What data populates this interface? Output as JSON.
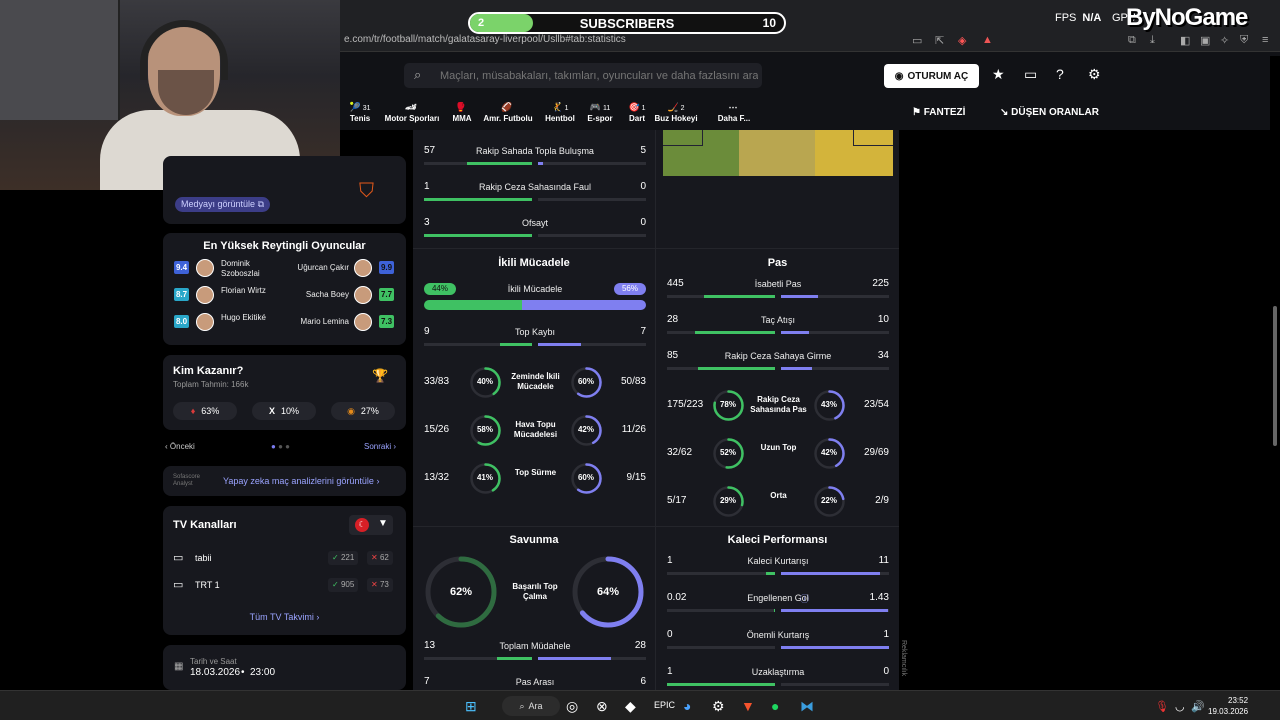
{
  "overlay": {
    "subscribers": {
      "label": "SUBSCRIBERS",
      "min": "2",
      "max": "10",
      "progress": 0.2
    },
    "fps_label": "FPS",
    "fps_value": "N/A",
    "gpu_label": "GPU",
    "logo": "ByNoGame"
  },
  "browser": {
    "url": "e.com/tr/football/match/galatasaray-liverpool/Usllb#tab:statistics"
  },
  "header": {
    "search_placeholder": "Maçları, müsabakaları, takımları, oyuncuları ve daha fazlasını ara",
    "login": "OTURUM AÇ",
    "sports": [
      {
        "label": "Tenis",
        "count": "31",
        "icon": "🎾"
      },
      {
        "label": "Motor Sporları",
        "count": "",
        "icon": "🏎"
      },
      {
        "label": "MMA",
        "count": "",
        "icon": "🥊"
      },
      {
        "label": "Amr. Futbolu",
        "count": "",
        "icon": "🏈"
      },
      {
        "label": "Hentbol",
        "count": "1",
        "icon": "🤾"
      },
      {
        "label": "E-spor",
        "count": "11",
        "icon": "🎮"
      },
      {
        "label": "Dart",
        "count": "1",
        "icon": "🎯"
      },
      {
        "label": "Buz Hokeyi",
        "count": "2",
        "icon": "🏒"
      },
      {
        "label": "Daha F...",
        "count": "",
        "icon": "⋯"
      }
    ],
    "fantezi": "FANTEZİ",
    "dusen": "DÜŞEN ORANLAR"
  },
  "media": {
    "label": "Medyayı görüntüle"
  },
  "top_players": {
    "title": "En Yüksek Reytingli Oyuncular",
    "rows": [
      {
        "l_rating": "9.4",
        "l_name": "Dominik Szoboszlai",
        "r_name": "Uğurcan Çakır",
        "r_rating": "9.9",
        "l_color": "#3e62d8",
        "r_color": "#3e62d8"
      },
      {
        "l_rating": "8.7",
        "l_name": "Florian Wirtz",
        "r_name": "Sacha Boey",
        "r_rating": "7.7",
        "l_color": "#2aa7c9",
        "r_color": "#3fc163"
      },
      {
        "l_rating": "8.0",
        "l_name": "Hugo Ekitiké",
        "r_name": "Mario Lemina",
        "r_rating": "7.3",
        "l_color": "#2aa7c9",
        "r_color": "#3fc163"
      }
    ]
  },
  "who_wins": {
    "title": "Kim Kazanır?",
    "subtitle": "Toplam Tahmin: 166k",
    "home": "63%",
    "draw_label": "X",
    "draw": "10%",
    "away": "27%"
  },
  "pager": {
    "prev": "Önceki",
    "next": "Sonraki"
  },
  "ai": {
    "logo_line1": "Sofascore",
    "logo_line2": "Analyst",
    "text": "Yapay zeka maç analizlerini görüntüle"
  },
  "tv": {
    "title": "TV Kanalları",
    "channels": [
      {
        "name": "tabii",
        "up": "221",
        "down": "62"
      },
      {
        "name": "TRT 1",
        "up": "905",
        "down": "73"
      }
    ],
    "all": "Tüm TV Takvimi"
  },
  "date": {
    "label": "Tarih ve Saat",
    "date": "18.03.2026",
    "time": "23:00"
  },
  "stats": {
    "top_rows": [
      {
        "label": "Rakip Sahada Topla Buluşma",
        "l": "57",
        "r": "5",
        "lf": 0.6,
        "rf": 0.05
      },
      {
        "label": "Rakip Ceza Sahasında Faul",
        "l": "1",
        "r": "0",
        "lf": 1.0,
        "rf": 0
      },
      {
        "label": "Ofsayt",
        "l": "3",
        "r": "0",
        "lf": 1.0,
        "rf": 0
      }
    ],
    "duels": {
      "title": "İkili Mücadele",
      "main_label": "İkili Mücadele",
      "l_pct": "44%",
      "r_pct": "56%",
      "l_frac": 0.44,
      "row": {
        "label": "Top Kaybı",
        "l": "9",
        "r": "7",
        "lf": 0.3,
        "rf": 0.4
      },
      "rings": [
        {
          "label": "Zeminde İkili Mücadele",
          "l": "33/83",
          "lp": "40%",
          "lv": 0.4,
          "rp": "60%",
          "rv": 0.6,
          "r": "50/83"
        },
        {
          "label": "Hava Topu Mücadelesi",
          "l": "15/26",
          "lp": "58%",
          "lv": 0.58,
          "rp": "42%",
          "rv": 0.42,
          "r": "11/26"
        },
        {
          "label": "Top Sürme",
          "l": "13/32",
          "lp": "41%",
          "lv": 0.41,
          "rp": "60%",
          "rv": 0.6,
          "r": "9/15"
        }
      ]
    },
    "pass": {
      "title": "Pas",
      "rows": [
        {
          "label": "İsabetli Pas",
          "l": "445",
          "r": "225",
          "lf": 0.66,
          "rf": 0.34
        },
        {
          "label": "Taç Atışı",
          "l": "28",
          "r": "10",
          "lf": 0.74,
          "rf": 0.26
        },
        {
          "label": "Rakip Ceza Sahaya Girme",
          "l": "85",
          "r": "34",
          "lf": 0.71,
          "rf": 0.29
        }
      ],
      "rings": [
        {
          "label": "Rakip Ceza Sahasında Pas",
          "l": "175/223",
          "lp": "78%",
          "lv": 0.78,
          "rp": "43%",
          "rv": 0.43,
          "r": "23/54"
        },
        {
          "label": "Uzun Top",
          "l": "32/62",
          "lp": "52%",
          "lv": 0.52,
          "rp": "42%",
          "rv": 0.42,
          "r": "29/69"
        },
        {
          "label": "Orta",
          "l": "5/17",
          "lp": "29%",
          "lv": 0.29,
          "rp": "22%",
          "rv": 0.22,
          "r": "2/9"
        }
      ]
    },
    "defense": {
      "title": "Savunma",
      "ring_label": "Başarılı Top Çalma",
      "lp": "62%",
      "lv": 0.62,
      "rp": "64%",
      "rv": 0.64,
      "rows": [
        {
          "label": "Toplam Müdahele",
          "l": "13",
          "r": "28",
          "lf": 0.32,
          "rf": 0.68
        },
        {
          "label": "Pas Arası",
          "l": "7",
          "r": "6",
          "lf": 0.5,
          "rf": 0.5
        }
      ]
    },
    "keeper": {
      "title": "Kaleci Performansı",
      "rows": [
        {
          "label": "Kaleci Kurtarışı",
          "l": "1",
          "r": "11",
          "lf": 0.08,
          "rf": 0.92
        },
        {
          "label": "Engellenen Gol",
          "l": "0.02",
          "r": "1.43",
          "lf": 0.01,
          "rf": 0.99
        },
        {
          "label": "Önemli Kurtarış",
          "l": "0",
          "r": "1",
          "lf": 0,
          "rf": 1
        },
        {
          "label": "Uzaklaştırma",
          "l": "1",
          "r": "0",
          "lf": 1,
          "rf": 0
        }
      ]
    }
  },
  "side_label": "Reklamcılık",
  "taskbar": {
    "search": "Ara",
    "time": "23:52",
    "date": "19.03.2026"
  }
}
